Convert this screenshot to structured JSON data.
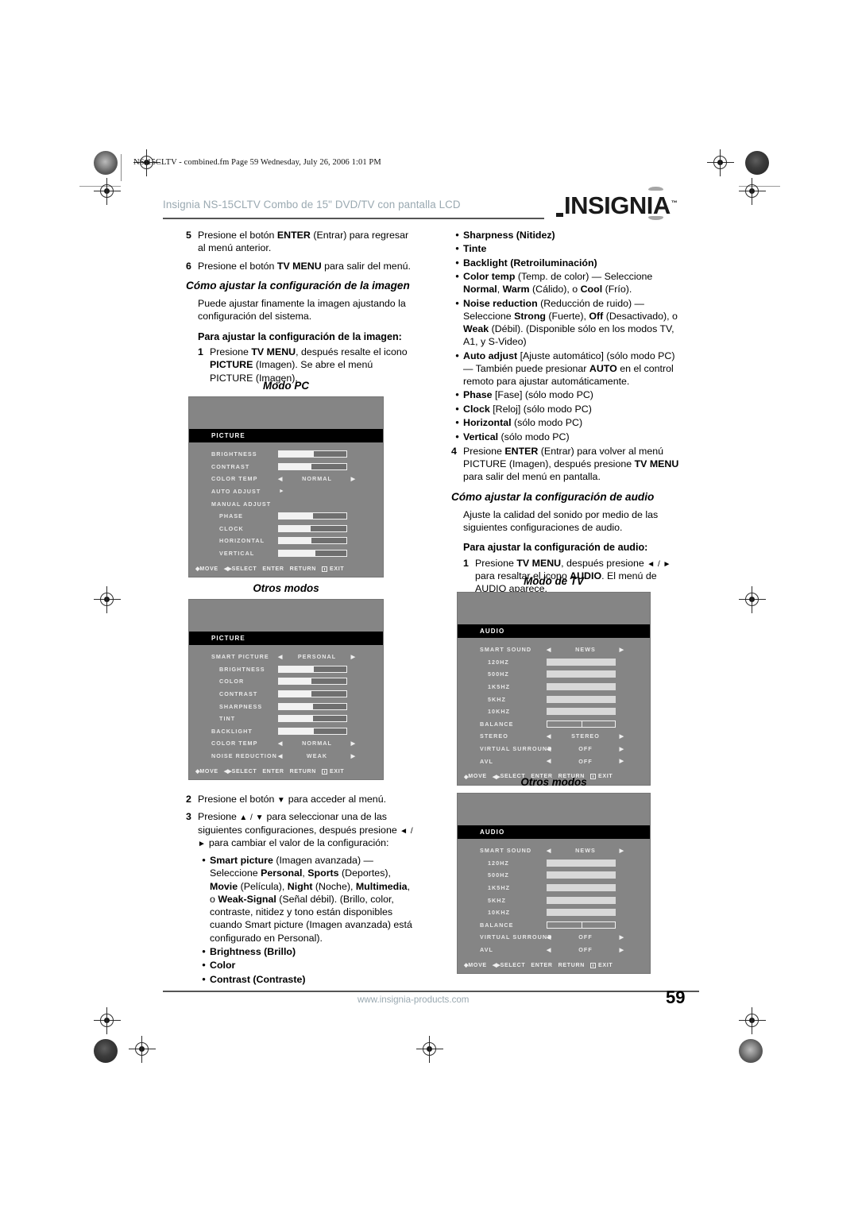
{
  "page": {
    "filename_bar": "NS-15CLTV - combined.fm  Page 59  Wednesday, July 26, 2006  1:01 PM",
    "running_head": "Insignia NS-15CLTV Combo de 15\" DVD/TV con pantalla LCD",
    "logo_text": "INSIGNIA",
    "logo_tm": "™",
    "logo_underscore": "_",
    "footer_url": "www.insignia-products.com",
    "page_number": "59"
  },
  "left_column": {
    "step5_num": "5",
    "step5_text_a": "Presione el botón ",
    "step5_bold": "ENTER",
    "step5_text_b": " (Entrar) para regresar al menú anterior.",
    "step6_num": "6",
    "step6_text_a": "Presione el botón ",
    "step6_bold": "TV MENU",
    "step6_text_b": " para salir del menú.",
    "heading_picture": "Cómo ajustar la configuración de la imagen",
    "intro_picture": "Puede ajustar finamente la imagen ajustando la configuración del sistema.",
    "subheading_picture": "Para ajustar la configuración de la imagen:",
    "step1_num": "1",
    "step1_text_a": "Presione ",
    "step1_bold_a": "TV MENU",
    "step1_text_b": ", después resalte el icono ",
    "step1_bold_b": "PICTURE",
    "step1_text_c": " (Imagen). Se abre el menú PICTURE (Imagen).",
    "fig1_caption": "Modo PC",
    "fig2_caption": "Otros modos",
    "step2_num": "2",
    "step2_text_a": "Presione el botón ",
    "step2_arrow": "▼",
    "step2_text_b": " para acceder al menú.",
    "step3_num": "3",
    "step3_text_a": "Presione ",
    "step3_arrow_a": "▲ / ▼",
    "step3_text_b": " para seleccionar una de las siguientes configuraciones, después presione ",
    "step3_arrow_b": "◄ / ►",
    "step3_text_c": " para cambiar el valor de la configuración:",
    "bullets": [
      {
        "bold": "Smart picture",
        "rest": " (Imagen avanzada) — Seleccione ",
        "segments": [
          {
            "t": "Personal",
            "b": true
          },
          {
            "t": ", ",
            "b": false
          },
          {
            "t": "Sports",
            "b": true
          },
          {
            "t": " (Deportes), ",
            "b": false
          },
          {
            "t": "Movie",
            "b": true
          },
          {
            "t": " (Película), ",
            "b": false
          },
          {
            "t": "Night",
            "b": true
          },
          {
            "t": " (Noche), ",
            "b": false
          },
          {
            "t": "Multimedia",
            "b": true
          },
          {
            "t": ", o ",
            "b": false
          },
          {
            "t": "Weak-Signal",
            "b": true
          },
          {
            "t": " (Señal débil). (Brillo, color, contraste, nitidez y tono están disponibles cuando Smart picture (Imagen avanzada) está configurado en Personal).",
            "b": false
          }
        ]
      },
      {
        "bold": "Brightness (Brillo)",
        "rest": "",
        "segments": []
      },
      {
        "bold": "Color",
        "rest": "",
        "segments": []
      },
      {
        "bold": "Contrast (Contraste)",
        "rest": "",
        "segments": []
      }
    ]
  },
  "right_column": {
    "bullets_top": [
      {
        "segments": [
          {
            "t": "Sharpness (Nitidez)",
            "b": true
          }
        ]
      },
      {
        "segments": [
          {
            "t": "Tinte",
            "b": true
          }
        ]
      },
      {
        "segments": [
          {
            "t": "Backlight (Retroiluminación)",
            "b": true
          }
        ]
      },
      {
        "segments": [
          {
            "t": "Color temp",
            "b": true
          },
          {
            "t": " (Temp. de color) — Seleccione ",
            "b": false
          },
          {
            "t": "Normal",
            "b": true
          },
          {
            "t": ", ",
            "b": false
          },
          {
            "t": "Warm",
            "b": true
          },
          {
            "t": " (Cálido), o ",
            "b": false
          },
          {
            "t": "Cool",
            "b": true
          },
          {
            "t": " (Frío).",
            "b": false
          }
        ]
      },
      {
        "segments": [
          {
            "t": "Noise reduction",
            "b": true
          },
          {
            "t": " (Reducción de ruido) — Seleccione ",
            "b": false
          },
          {
            "t": "Strong",
            "b": true
          },
          {
            "t": " (Fuerte), ",
            "b": false
          },
          {
            "t": "Off",
            "b": true
          },
          {
            "t": " (Desactivado), o ",
            "b": false
          },
          {
            "t": "Weak",
            "b": true
          },
          {
            "t": " (Débil). (Disponible sólo en los modos TV, A1, y S-Video)",
            "b": false
          }
        ]
      },
      {
        "segments": [
          {
            "t": "Auto adjust",
            "b": true
          },
          {
            "t": " [Ajuste automático] (sólo modo PC) — También puede presionar ",
            "b": false
          },
          {
            "t": "AUTO",
            "b": true
          },
          {
            "t": " en el control remoto para ajustar automáticamente.",
            "b": false
          }
        ]
      },
      {
        "segments": [
          {
            "t": "Phase",
            "b": true
          },
          {
            "t": " [Fase] (sólo modo PC)",
            "b": false
          }
        ]
      },
      {
        "segments": [
          {
            "t": "Clock",
            "b": true
          },
          {
            "t": " [Reloj] (sólo modo PC)",
            "b": false
          }
        ]
      },
      {
        "segments": [
          {
            "t": "Horizontal",
            "b": true
          },
          {
            "t": " (sólo modo PC)",
            "b": false
          }
        ]
      },
      {
        "segments": [
          {
            "t": "Vertical",
            "b": true
          },
          {
            "t": " (sólo modo PC)",
            "b": false
          }
        ]
      }
    ],
    "step4_num": "4",
    "step4_text_a": "Presione ",
    "step4_bold_a": "ENTER",
    "step4_text_b": " (Entrar) para volver al menú PICTURE (Imagen), después presione ",
    "step4_bold_b": "TV MENU",
    "step4_text_c": " para salir del menú en pantalla.",
    "heading_audio": "Cómo ajustar la configuración de audio",
    "intro_audio": "Ajuste la calidad del sonido por medio de las siguientes configuraciones de audio.",
    "subheading_audio": "Para ajustar la configuración de audio:",
    "step1_num": "1",
    "step1_text_a": "Presione ",
    "step1_bold_a": "TV MENU",
    "step1_text_b": ", después presione ",
    "step1_arrow": "◄ / ►",
    "step1_text_c": " para resaltar el icono ",
    "step1_bold_b": "AUDIO",
    "step1_text_d": ". El menú de AUDIO aparece.",
    "fig3_caption": "Modo de TV",
    "fig4_caption": "Otros modos"
  },
  "osd_menus": {
    "picture_pc": {
      "title": "PICTURE",
      "rows": [
        {
          "label": "BRIGHTNESS",
          "type": "bar",
          "fill": 52
        },
        {
          "label": "CONTRAST",
          "type": "bar",
          "fill": 48
        },
        {
          "label": "COLOR  TEMP",
          "type": "option",
          "value": "NORMAL"
        },
        {
          "label": "AUTO ADJUST",
          "type": "arrow",
          "value": "►"
        },
        {
          "label": "MANUAL ADJUST",
          "type": "none",
          "value": ""
        },
        {
          "label": "PHASE",
          "type": "bar",
          "fill": 50,
          "sub": true
        },
        {
          "label": "CLOCK",
          "type": "bar",
          "fill": 47,
          "sub": true
        },
        {
          "label": "HORIZONTAL",
          "type": "bar",
          "fill": 48,
          "sub": true
        },
        {
          "label": "VERTICAL",
          "type": "bar",
          "fill": 54,
          "sub": true
        }
      ],
      "footer": {
        "move": "MOVE",
        "select": "SELECT",
        "enter": "ENTER",
        "return": "RETURN",
        "exit": "EXIT"
      }
    },
    "picture_other": {
      "title": "PICTURE",
      "rows": [
        {
          "label": "SMART PICTURE",
          "type": "option",
          "value": "PERSONAL"
        },
        {
          "label": "BRIGHTNESS",
          "type": "bar",
          "fill": 52,
          "sub": true
        },
        {
          "label": "COLOR",
          "type": "bar",
          "fill": 48,
          "sub": true
        },
        {
          "label": "CONTRAST",
          "type": "bar",
          "fill": 48,
          "sub": true
        },
        {
          "label": "SHARPNESS",
          "type": "bar",
          "fill": 50,
          "sub": true
        },
        {
          "label": "TINT",
          "type": "bar",
          "fill": 50,
          "sub": true
        },
        {
          "label": "BACKLIGHT",
          "type": "bar",
          "fill": 52
        },
        {
          "label": "COLOR TEMP",
          "type": "option",
          "value": "NORMAL"
        },
        {
          "label": "NOISE REDUCTION",
          "type": "option",
          "value": "WEAK"
        }
      ],
      "footer": {
        "move": "MOVE",
        "select": "SELECT",
        "enter": "ENTER",
        "return": "RETURN",
        "exit": "EXIT"
      }
    },
    "audio_tv": {
      "title": "AUDIO",
      "rows": [
        {
          "label": "SMART SOUND",
          "type": "option",
          "value": "NEWS"
        },
        {
          "label": "120HZ",
          "type": "flatbar",
          "sub": true
        },
        {
          "label": "500HZ",
          "type": "flatbar",
          "sub": true
        },
        {
          "label": "1K5HZ",
          "type": "flatbar",
          "sub": true
        },
        {
          "label": "5KHZ",
          "type": "flatbar",
          "sub": true
        },
        {
          "label": "10KHZ",
          "type": "flatbar",
          "sub": true
        },
        {
          "label": "BALANCE",
          "type": "balance"
        },
        {
          "label": "STEREO",
          "type": "option",
          "value": "STEREO"
        },
        {
          "label": "VIRTUAL SURROUND",
          "type": "option",
          "value": "OFF"
        },
        {
          "label": "AVL",
          "type": "option",
          "value": "OFF"
        }
      ],
      "footer": {
        "move": "MOVE",
        "select": "SELECT",
        "enter": "ENTER",
        "return": "RETURN",
        "exit": "EXIT"
      }
    },
    "audio_other": {
      "title": "AUDIO",
      "rows": [
        {
          "label": "SMART SOUND",
          "type": "option",
          "value": "NEWS"
        },
        {
          "label": "120HZ",
          "type": "flatbar",
          "sub": true
        },
        {
          "label": "500HZ",
          "type": "flatbar",
          "sub": true
        },
        {
          "label": "1K5HZ",
          "type": "flatbar",
          "sub": true
        },
        {
          "label": "5KHZ",
          "type": "flatbar",
          "sub": true
        },
        {
          "label": "10KHZ",
          "type": "flatbar",
          "sub": true
        },
        {
          "label": "BALANCE",
          "type": "balance"
        },
        {
          "label": "VIRTUAL SURROUND",
          "type": "option",
          "value": "OFF"
        },
        {
          "label": "AVL",
          "type": "option",
          "value": "OFF"
        }
      ],
      "footer": {
        "move": "MOVE",
        "select": "SELECT",
        "enter": "ENTER",
        "return": "RETURN",
        "exit": "EXIT"
      }
    }
  }
}
